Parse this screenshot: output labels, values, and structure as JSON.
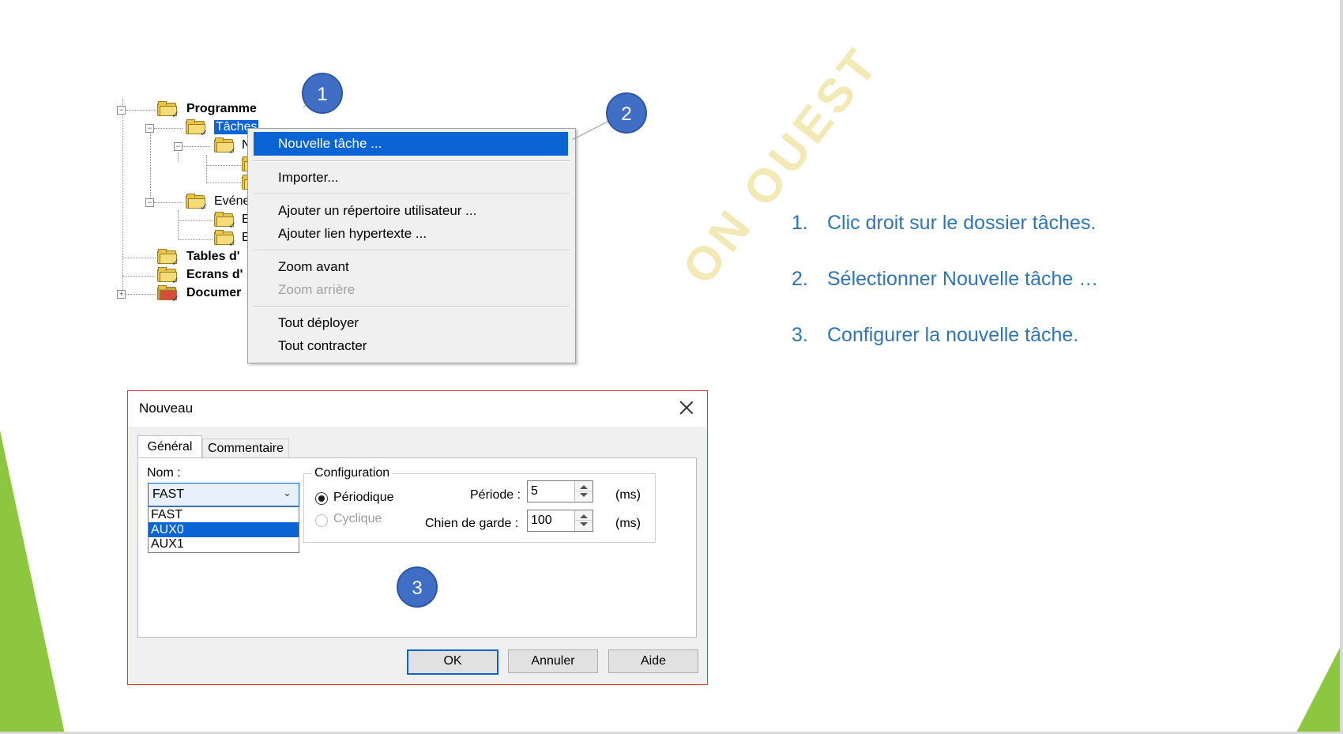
{
  "tree": {
    "items": [
      {
        "label": "Programme"
      },
      {
        "label": "Tâches"
      },
      {
        "label": "Evéne"
      },
      {
        "label": "Tables d'"
      },
      {
        "label": "Ecrans d'"
      },
      {
        "label": "Documer"
      }
    ],
    "partial_labels": [
      "N",
      "E",
      "E"
    ]
  },
  "context_menu": {
    "items": [
      {
        "label": "Nouvelle tâche ...",
        "state": "highlighted"
      },
      {
        "label": "Importer...",
        "state": "normal"
      },
      {
        "label": "Ajouter un répertoire utilisateur ...",
        "state": "normal"
      },
      {
        "label": "Ajouter lien hypertexte ...",
        "state": "normal"
      },
      {
        "label": "Zoom avant",
        "state": "normal"
      },
      {
        "label": "Zoom arrière",
        "state": "disabled"
      },
      {
        "label": "Tout déployer",
        "state": "normal"
      },
      {
        "label": "Tout contracter",
        "state": "normal"
      }
    ]
  },
  "dialog": {
    "title": "Nouveau",
    "tabs": [
      {
        "label": "Général",
        "active": true
      },
      {
        "label": "Commentaire",
        "active": false
      }
    ],
    "name_label": "Nom :",
    "name_value": "FAST",
    "name_options": [
      {
        "label": "FAST",
        "selected": false
      },
      {
        "label": "AUX0",
        "selected": true
      },
      {
        "label": "AUX1",
        "selected": false
      }
    ],
    "config": {
      "legend": "Configuration",
      "periodic_label": "Périodique",
      "periodic_checked": true,
      "cyclic_label": "Cyclique",
      "cyclic_enabled": false,
      "period_label": "Période :",
      "period_value": "5",
      "period_unit": "(ms)",
      "watchdog_label": "Chien de garde :",
      "watchdog_value": "100",
      "watchdog_unit": "(ms)"
    },
    "buttons": {
      "ok": "OK",
      "cancel": "Annuler",
      "help": "Aide"
    }
  },
  "callouts": [
    "1",
    "2",
    "3"
  ],
  "instructions": [
    {
      "num": "1.",
      "text": "Clic droit sur le dossier tâches."
    },
    {
      "num": "2.",
      "text": "Sélectionner Nouvelle tâche …"
    },
    {
      "num": "3.",
      "text": "Configurer la nouvelle tâche."
    }
  ],
  "watermark": "ON OUEST",
  "colors": {
    "accent_blue": "#0a64d4",
    "instruction_blue": "#2f75b5",
    "callout_blue": "#3f6ec4",
    "dialog_border_red": "#e0313c",
    "slide_green": "#8dc63f"
  }
}
